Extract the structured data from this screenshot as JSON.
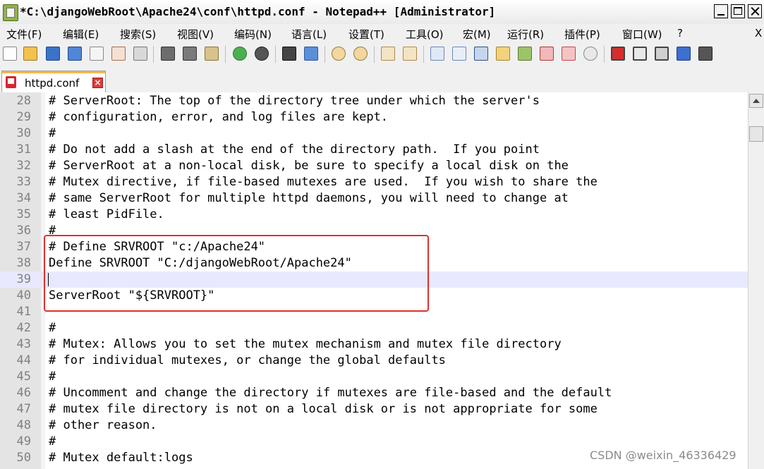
{
  "window": {
    "title": "*C:\\djangoWebRoot\\Apache24\\conf\\httpd.conf - Notepad++ [Administrator]"
  },
  "menu": {
    "items": [
      "文件(F)",
      "编辑(E)",
      "搜索(S)",
      "视图(V)",
      "编码(N)",
      "语言(L)",
      "设置(T)",
      "工具(O)",
      "宏(M)",
      "运行(R)",
      "插件(P)",
      "窗口(W)",
      "?"
    ],
    "close_label": "X"
  },
  "toolbar": {
    "icons": [
      "new-file-icon",
      "open-file-icon",
      "save-icon",
      "save-all-icon",
      "close-icon",
      "close-all-icon",
      "print-icon",
      "cut-icon",
      "copy-icon",
      "paste-icon",
      "undo-icon",
      "redo-icon",
      "find-icon",
      "replace-icon",
      "zoom-in-icon",
      "zoom-out-icon",
      "sync-vertical-icon",
      "sync-horizontal-icon",
      "word-wrap-icon",
      "show-all-chars-icon",
      "indent-guide-icon",
      "doc-map-icon",
      "function-list-icon",
      "folder-workspace-icon",
      "monitor-icon",
      "record-macro-icon",
      "stop-macro-icon",
      "play-macro-icon",
      "run-macro-multiple-icon",
      "save-macro-icon"
    ]
  },
  "tab": {
    "label": "httpd.conf"
  },
  "editor": {
    "lines": [
      {
        "num": "28",
        "text": "# ServerRoot: The top of the directory tree under which the server's"
      },
      {
        "num": "29",
        "text": "# configuration, error, and log files are kept."
      },
      {
        "num": "30",
        "text": "#"
      },
      {
        "num": "31",
        "text": "# Do not add a slash at the end of the directory path.  If you point"
      },
      {
        "num": "32",
        "text": "# ServerRoot at a non-local disk, be sure to specify a local disk on the"
      },
      {
        "num": "33",
        "text": "# Mutex directive, if file-based mutexes are used.  If you wish to share the"
      },
      {
        "num": "34",
        "text": "# same ServerRoot for multiple httpd daemons, you will need to change at"
      },
      {
        "num": "35",
        "text": "# least PidFile."
      },
      {
        "num": "36",
        "text": "#"
      },
      {
        "num": "37",
        "text": "# Define SRVROOT \"c:/Apache24\""
      },
      {
        "num": "38",
        "text": "Define SRVROOT \"C:/djangoWebRoot/Apache24\""
      },
      {
        "num": "39",
        "text": ""
      },
      {
        "num": "40",
        "text": "ServerRoot \"${SRVROOT}\""
      },
      {
        "num": "41",
        "text": ""
      },
      {
        "num": "42",
        "text": "#"
      },
      {
        "num": "43",
        "text": "# Mutex: Allows you to set the mutex mechanism and mutex file directory"
      },
      {
        "num": "44",
        "text": "# for individual mutexes, or change the global defaults"
      },
      {
        "num": "45",
        "text": "#"
      },
      {
        "num": "46",
        "text": "# Uncomment and change the directory if mutexes are file-based and the default"
      },
      {
        "num": "47",
        "text": "# mutex file directory is not on a local disk or is not appropriate for some"
      },
      {
        "num": "48",
        "text": "# other reason."
      },
      {
        "num": "49",
        "text": "#"
      },
      {
        "num": "50",
        "text": "# Mutex default:logs"
      }
    ],
    "current_line": "39"
  },
  "watermark": "CSDN @weixin_46336429"
}
